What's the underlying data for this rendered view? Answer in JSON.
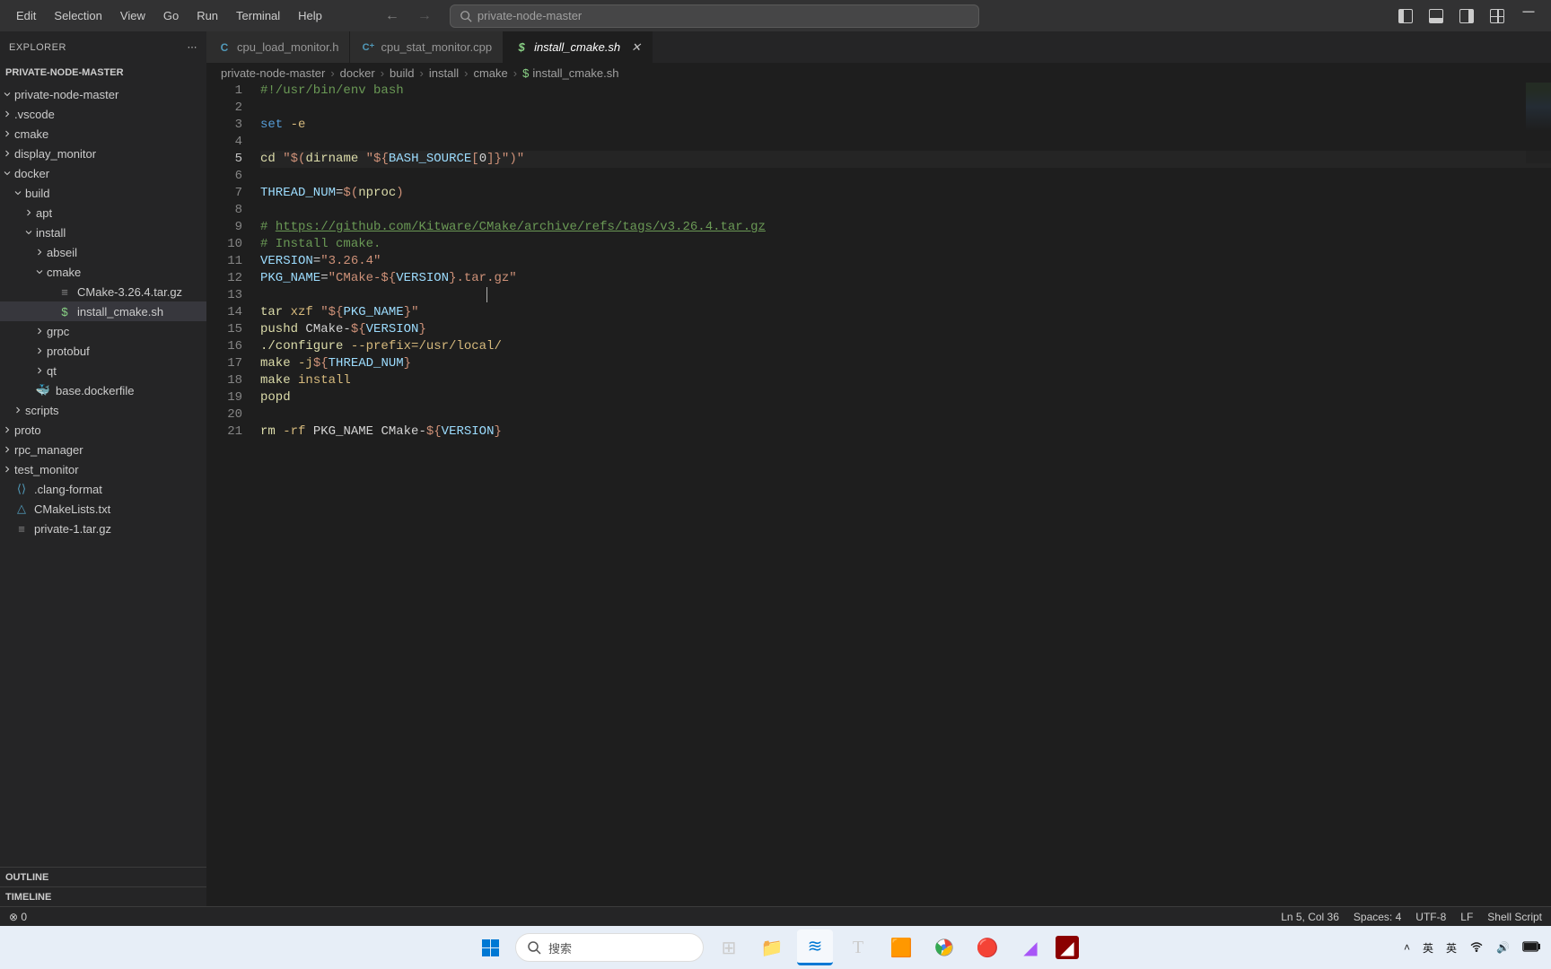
{
  "menu": [
    "Edit",
    "Selection",
    "View",
    "Go",
    "Run",
    "Terminal",
    "Help"
  ],
  "search_placeholder": "private-node-master",
  "explorer": {
    "title": "EXPLORER",
    "project": "PRIVATE-NODE-MASTER"
  },
  "tree": [
    {
      "depth": 0,
      "expanded": true,
      "type": "folder",
      "label": "private-node-master"
    },
    {
      "depth": 0,
      "expanded": false,
      "type": "folder",
      "label": ".vscode"
    },
    {
      "depth": 0,
      "expanded": false,
      "type": "folder",
      "label": "cmake"
    },
    {
      "depth": 0,
      "expanded": false,
      "type": "folder",
      "label": "display_monitor"
    },
    {
      "depth": 0,
      "expanded": true,
      "type": "folder",
      "label": "docker"
    },
    {
      "depth": 1,
      "expanded": true,
      "type": "folder",
      "label": "build"
    },
    {
      "depth": 2,
      "expanded": false,
      "type": "folder",
      "label": "apt"
    },
    {
      "depth": 2,
      "expanded": true,
      "type": "folder",
      "label": "install"
    },
    {
      "depth": 3,
      "expanded": false,
      "type": "folder",
      "label": "abseil"
    },
    {
      "depth": 3,
      "expanded": true,
      "type": "folder",
      "label": "cmake"
    },
    {
      "depth": 4,
      "expanded": null,
      "type": "file",
      "icon": "archive",
      "label": "CMake-3.26.4.tar.gz"
    },
    {
      "depth": 4,
      "expanded": null,
      "type": "file",
      "icon": "sh",
      "label": "install_cmake.sh",
      "selected": true
    },
    {
      "depth": 3,
      "expanded": false,
      "type": "folder",
      "label": "grpc"
    },
    {
      "depth": 3,
      "expanded": false,
      "type": "folder",
      "label": "protobuf"
    },
    {
      "depth": 3,
      "expanded": false,
      "type": "folder",
      "label": "qt"
    },
    {
      "depth": 2,
      "expanded": null,
      "type": "file",
      "icon": "docker",
      "label": "base.dockerfile"
    },
    {
      "depth": 1,
      "expanded": false,
      "type": "folder",
      "label": "scripts"
    },
    {
      "depth": 0,
      "expanded": false,
      "type": "folder",
      "label": "proto"
    },
    {
      "depth": 0,
      "expanded": false,
      "type": "folder",
      "label": "rpc_manager"
    },
    {
      "depth": 0,
      "expanded": false,
      "type": "folder",
      "label": "test_monitor"
    },
    {
      "depth": 0,
      "expanded": null,
      "type": "file",
      "icon": "clang",
      "label": ".clang-format"
    },
    {
      "depth": 0,
      "expanded": null,
      "type": "file",
      "icon": "cmake",
      "label": "CMakeLists.txt"
    },
    {
      "depth": 0,
      "expanded": null,
      "type": "file",
      "icon": "archive",
      "label": "private-1.tar.gz"
    }
  ],
  "sidebar_panels": {
    "outline": "OUTLINE",
    "timeline": "TIMELINE"
  },
  "tabs": [
    {
      "icon": "c",
      "label": "cpu_load_monitor.h",
      "active": false,
      "close": false
    },
    {
      "icon": "cpp",
      "label": "cpu_stat_monitor.cpp",
      "active": false,
      "close": false
    },
    {
      "icon": "sh",
      "label": "install_cmake.sh",
      "active": true,
      "close": true
    }
  ],
  "breadcrumbs": [
    "private-node-master",
    "docker",
    "build",
    "install",
    "cmake",
    "install_cmake.sh"
  ],
  "code_lines": [
    {
      "n": 1,
      "html": "<span class='tok-comment'>#!/usr/bin/env bash</span>"
    },
    {
      "n": 2,
      "html": ""
    },
    {
      "n": 3,
      "html": "<span class='tok-keyword'>set</span> <span class='tok-param'>-e</span>"
    },
    {
      "n": 4,
      "html": ""
    },
    {
      "n": 5,
      "current": true,
      "html": "<span class='tok-cmd'>cd</span> <span class='tok-string'>\"$(</span><span class='tok-cmd'>dirname</span> <span class='tok-string'>\"${</span><span class='tok-var'>BASH_SOURCE</span><span class='tok-string'>[</span>0<span class='tok-string'>]}\"</span><span class='tok-string'>)\"</span>"
    },
    {
      "n": 6,
      "html": ""
    },
    {
      "n": 7,
      "html": "<span class='tok-var'>THREAD_NUM</span>=<span class='tok-string'>$(</span><span class='tok-cmd'>nproc</span><span class='tok-string'>)</span>"
    },
    {
      "n": 8,
      "html": ""
    },
    {
      "n": 9,
      "html": "<span class='tok-comment'># </span><span class='tok-url'>https://github.com/Kitware/CMake/archive/refs/tags/v3.26.4.tar.gz</span>"
    },
    {
      "n": 10,
      "html": "<span class='tok-comment'># Install cmake.</span>"
    },
    {
      "n": 11,
      "html": "<span class='tok-var'>VERSION</span>=<span class='tok-string'>\"3.26.4\"</span>"
    },
    {
      "n": 12,
      "html": "<span class='tok-var'>PKG_NAME</span>=<span class='tok-string'>\"CMake-${</span><span class='tok-var'>VERSION</span><span class='tok-string'>}.tar.gz\"</span>"
    },
    {
      "n": 13,
      "html": "                              <span class='cursor-blink'></span>"
    },
    {
      "n": 14,
      "html": "<span class='tok-cmd'>tar</span> <span class='tok-param'>xzf</span> <span class='tok-string'>\"${</span><span class='tok-var'>PKG_NAME</span><span class='tok-string'>}\"</span>"
    },
    {
      "n": 15,
      "html": "<span class='tok-cmd'>pushd</span> CMake-<span class='tok-string'>${</span><span class='tok-var'>VERSION</span><span class='tok-string'>}</span>"
    },
    {
      "n": 16,
      "html": "<span class='tok-cmd'>./configure</span> <span class='tok-param'>--prefix=/usr/local/</span>"
    },
    {
      "n": 17,
      "html": "<span class='tok-cmd'>make</span> <span class='tok-param'>-j</span><span class='tok-string'>${</span><span class='tok-var'>THREAD_NUM</span><span class='tok-string'>}</span>"
    },
    {
      "n": 18,
      "html": "<span class='tok-cmd'>make</span> <span class='tok-param'>install</span>"
    },
    {
      "n": 19,
      "html": "<span class='tok-cmd'>popd</span>"
    },
    {
      "n": 20,
      "html": ""
    },
    {
      "n": 21,
      "html": "<span class='tok-cmd'>rm</span> <span class='tok-param'>-rf</span> PKG_NAME CMake-<span class='tok-string'>${</span><span class='tok-var'>VERSION</span><span class='tok-string'>}</span>"
    }
  ],
  "status": {
    "left_err": "0",
    "ln_col": "Ln 5, Col 36",
    "spaces": "Spaces: 4",
    "encoding": "UTF-8",
    "eol": "LF",
    "lang": "Shell Script"
  },
  "taskbar": {
    "search_placeholder": "搜索",
    "ime": {
      "a": "英",
      "b": "英"
    }
  }
}
